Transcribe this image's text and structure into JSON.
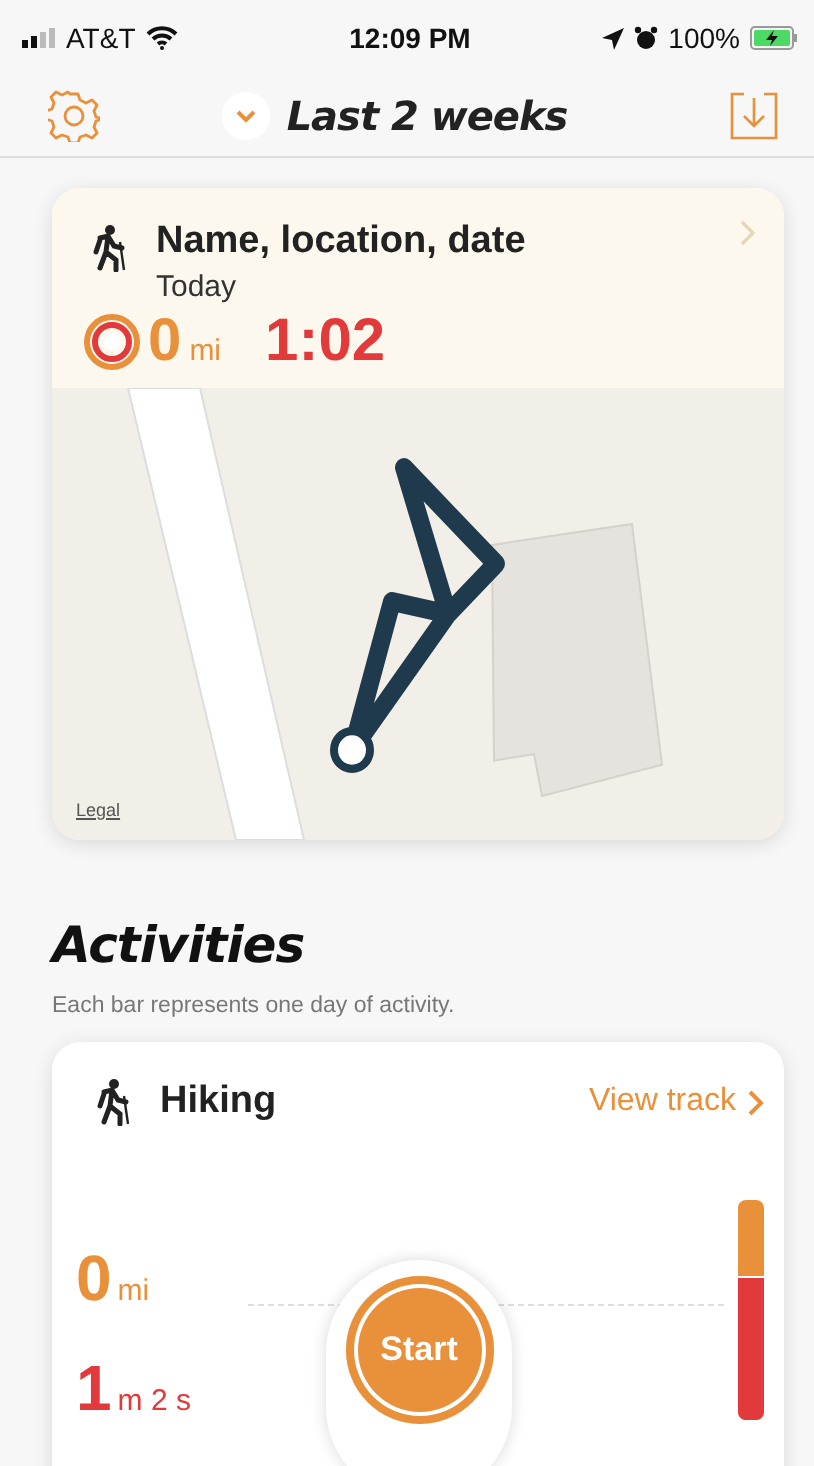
{
  "status_bar": {
    "carrier": "AT&T",
    "time": "12:09 PM",
    "battery": "100%"
  },
  "nav": {
    "title": "Last 2 weeks"
  },
  "track_card": {
    "title": "Name, location, date",
    "date": "Today",
    "distance": "0",
    "distance_unit": "mi",
    "duration": "1:02",
    "map_legal": "Legal"
  },
  "activities": {
    "title": "Activities",
    "subtitle": "Each bar represents one day of activity.",
    "card": {
      "name": "Hiking",
      "link": "View track",
      "distance": "0",
      "distance_unit": "mi",
      "time_value": "1",
      "time_unit": "m 2 s",
      "start": "Start",
      "level": 0.65
    }
  }
}
